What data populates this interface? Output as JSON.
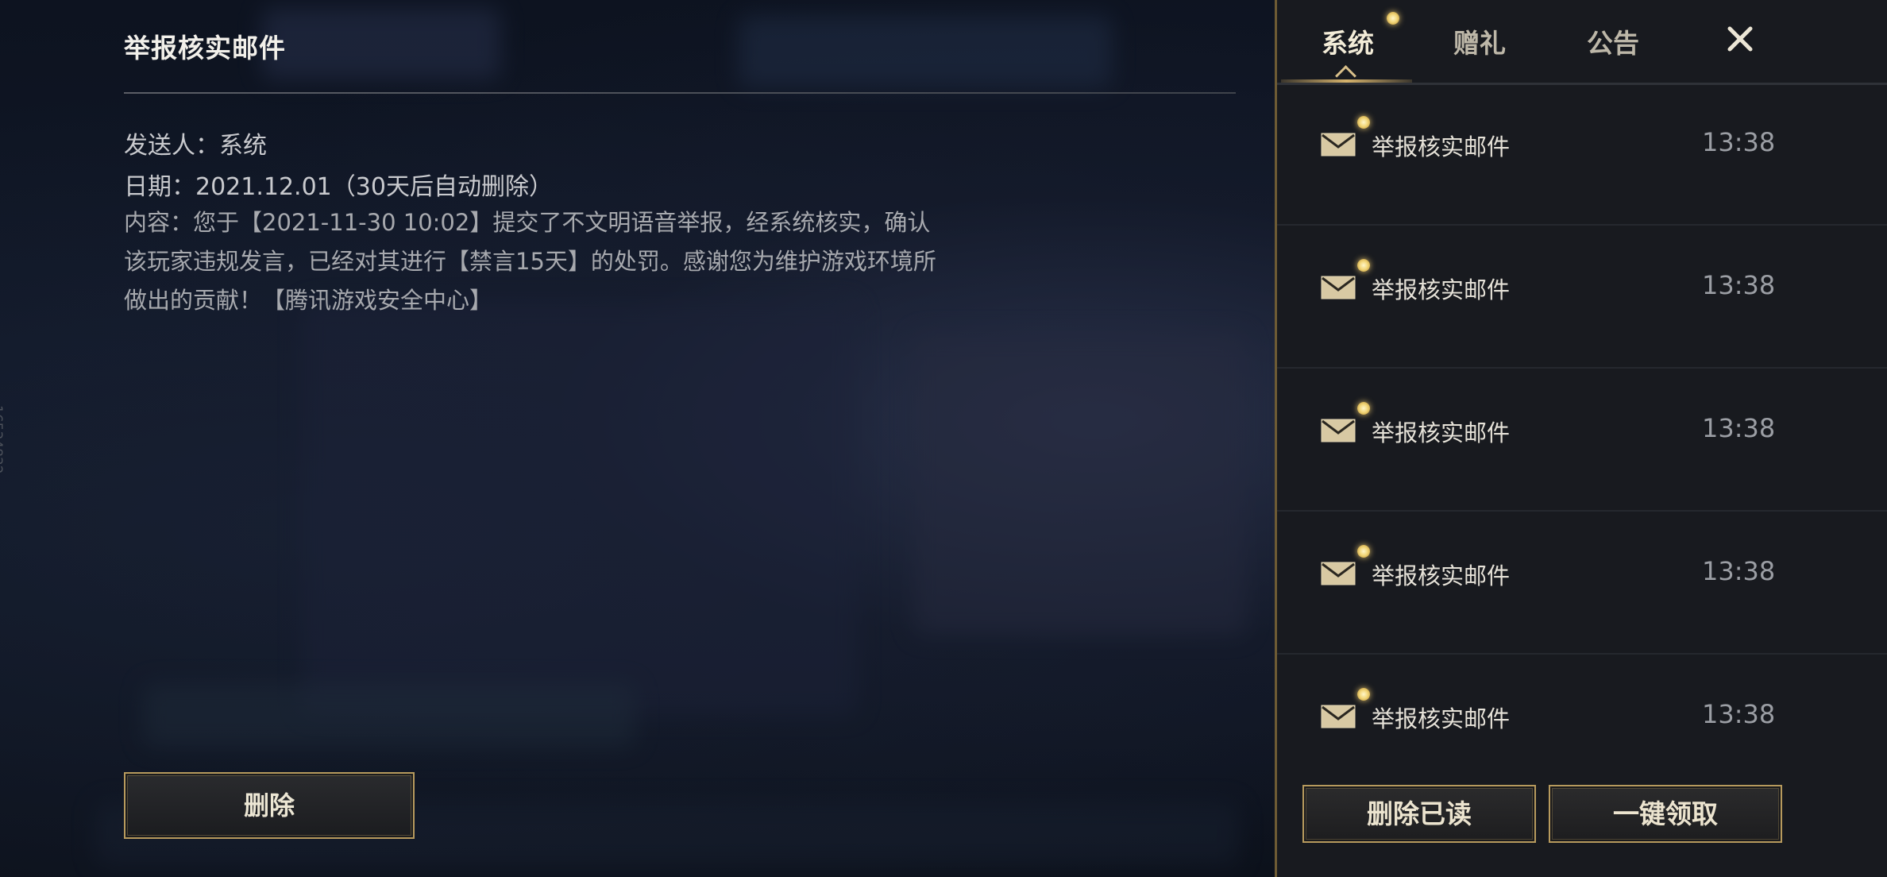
{
  "detail": {
    "title": "举报核实邮件",
    "sender": "发送人：系统",
    "date": "日期：2021.12.01（30天后自动删除）",
    "content_line1": "内容：您于【2021-11-30 10:02】提交了不文明语音举报，经系统核实，确认",
    "content_line2": "该玩家违规发言，已经对其进行【禁言15天】的处罚。感谢您为维护游戏环境所",
    "content_line3": "做出的贡献！【腾讯游戏安全中心】",
    "delete_label": "删除"
  },
  "watermark_id": "16534832",
  "tabs": [
    {
      "label": "系统",
      "active": true,
      "has_notification": true
    },
    {
      "label": "赠礼",
      "active": false,
      "has_notification": false
    },
    {
      "label": "公告",
      "active": false,
      "has_notification": false
    }
  ],
  "close_icon": "close-icon",
  "mail_items": [
    {
      "subject": "举报核实邮件",
      "time": "13:38",
      "unread": true,
      "icon": "envelope-icon"
    },
    {
      "subject": "举报核实邮件",
      "time": "13:38",
      "unread": true,
      "icon": "envelope-icon"
    },
    {
      "subject": "举报核实邮件",
      "time": "13:38",
      "unread": true,
      "icon": "envelope-icon"
    },
    {
      "subject": "举报核实邮件",
      "time": "13:38",
      "unread": true,
      "icon": "envelope-icon"
    },
    {
      "subject": "举报核实邮件",
      "time": "13:38",
      "unread": true,
      "icon": "envelope-icon"
    }
  ],
  "actions": {
    "delete_read_label": "删除已读",
    "claim_all_label": "一键领取"
  },
  "colors": {
    "accent_gold": "#b79a5d",
    "notification_dot": "#f3d77a",
    "panel_bg": "#181a1f"
  }
}
